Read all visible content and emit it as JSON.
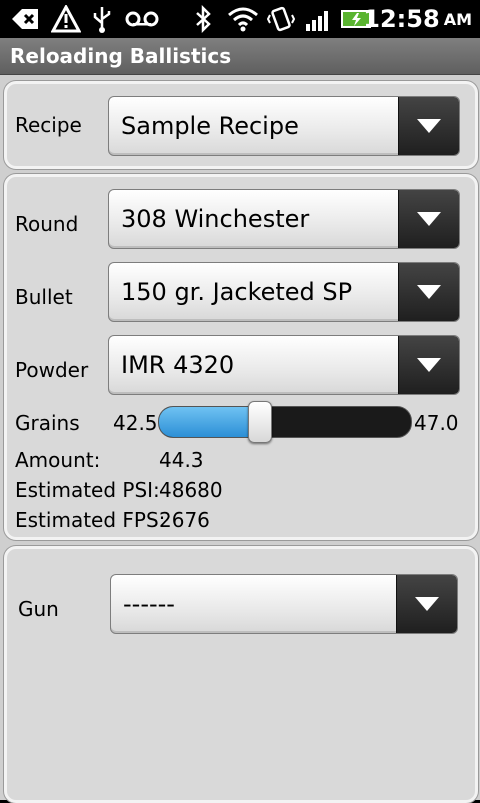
{
  "status_bar": {
    "time": "12:58",
    "ampm": "AM",
    "icons": [
      "back-icon",
      "alert-icon",
      "usb-icon",
      "voicemail-icon",
      "bluetooth-icon",
      "wifi-icon",
      "vibrate-icon",
      "signal-icon",
      "battery-icon"
    ]
  },
  "app": {
    "title": "Reloading Ballistics"
  },
  "recipe": {
    "label": "Recipe",
    "value": "Sample Recipe"
  },
  "load": {
    "round_label": "Round",
    "round_value": "308 Winchester",
    "bullet_label": "Bullet",
    "bullet_value": "150 gr. Jacketed SP",
    "powder_label": "Powder",
    "powder_value": "IMR 4320",
    "grains_label": "Grains",
    "grains_min": "42.5",
    "grains_max": "47.0",
    "grains_fraction": 0.4,
    "amount_label": "Amount:",
    "amount_value": "44.3",
    "psi_label": "Estimated PSI:",
    "psi_value": "48680",
    "fps_label": "Estimated FPS:",
    "fps_value": "2676"
  },
  "gun": {
    "label": "Gun",
    "value": "------"
  },
  "colors": {
    "slider_fill": "#2c8fd6",
    "background": "#cfcfcf"
  }
}
